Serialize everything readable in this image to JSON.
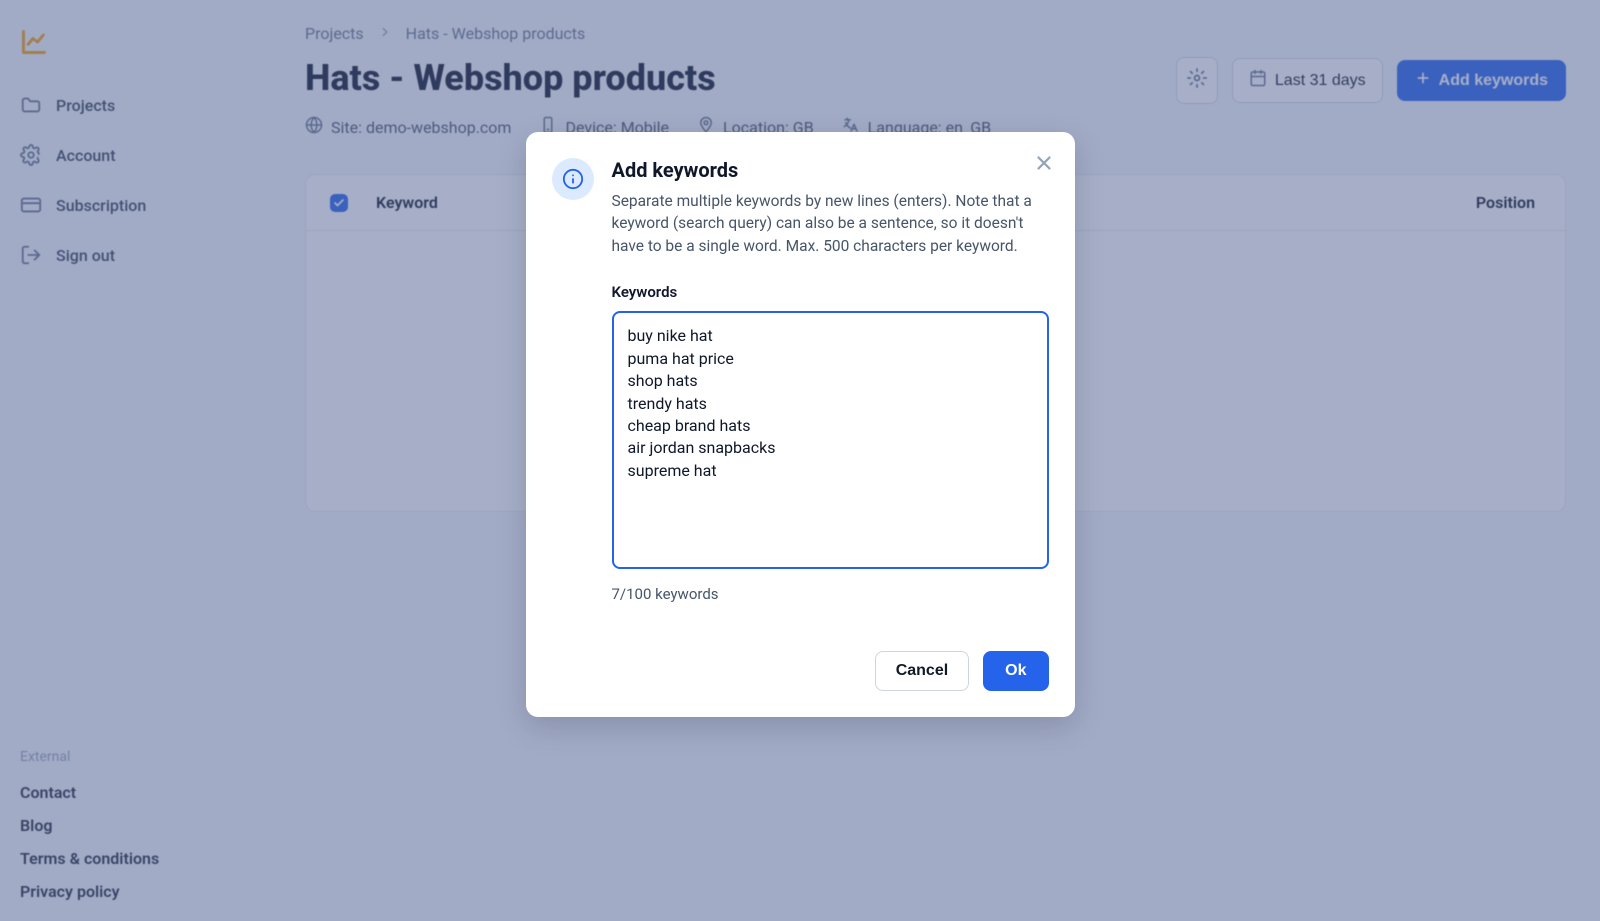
{
  "sidebar": {
    "nav": [
      {
        "key": "projects",
        "label": "Projects"
      },
      {
        "key": "account",
        "label": "Account"
      },
      {
        "key": "subscription",
        "label": "Subscription"
      },
      {
        "key": "signout",
        "label": "Sign out"
      }
    ],
    "external_label": "External",
    "footer": [
      "Contact",
      "Blog",
      "Terms & conditions",
      "Privacy policy"
    ]
  },
  "breadcrumb": {
    "items": [
      "Projects",
      "Hats - Webshop products"
    ]
  },
  "header": {
    "title": "Hats - Webshop products",
    "date_button": "Last 31 days",
    "add_button": "Add keywords"
  },
  "meta": {
    "site_label": "Site: demo-webshop.com",
    "device_label": "Device: Mobile",
    "location_label": "Location: GB",
    "language_label": "Language: en_GB"
  },
  "table": {
    "col_keyword": "Keyword",
    "col_position": "Position",
    "empty_msg": "."
  },
  "modal": {
    "title": "Add keywords",
    "description": "Separate multiple keywords by new lines (enters). Note that a keyword (search query) can also be a sentence, so it doesn't have to be a single word. Max. 500 characters per keyword.",
    "field_label": "Keywords",
    "textarea_value": "buy nike hat\npuma hat price\nshop hats\ntrendy hats\ncheap brand hats\nair jordan snapbacks\nsupreme hat",
    "counter": "7/100 keywords",
    "cancel": "Cancel",
    "ok": "Ok"
  }
}
